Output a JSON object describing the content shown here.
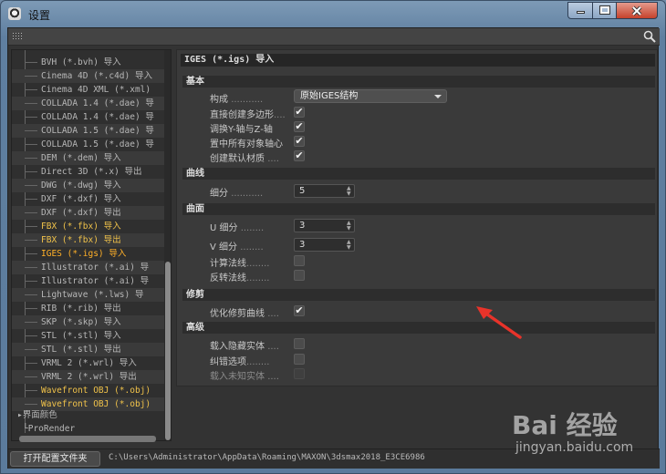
{
  "window": {
    "title": "设置"
  },
  "tree": {
    "items": [
      {
        "label": "BVH (*.bvh) 导入",
        "style": "normal"
      },
      {
        "label": "Cinema 4D (*.c4d) 导入",
        "style": "normal"
      },
      {
        "label": "Cinema 4D XML (*.xml)",
        "style": "normal"
      },
      {
        "label": "COLLADA 1.4 (*.dae) 导",
        "style": "normal"
      },
      {
        "label": "COLLADA 1.4 (*.dae) 导",
        "style": "normal"
      },
      {
        "label": "COLLADA 1.5 (*.dae) 导",
        "style": "normal"
      },
      {
        "label": "COLLADA 1.5 (*.dae) 导",
        "style": "normal"
      },
      {
        "label": "DEM (*.dem) 导入",
        "style": "normal"
      },
      {
        "label": "Direct 3D (*.x) 导出",
        "style": "normal"
      },
      {
        "label": "DWG (*.dwg) 导入",
        "style": "normal"
      },
      {
        "label": "DXF (*.dxf) 导入",
        "style": "normal"
      },
      {
        "label": "DXF (*.dxf) 导出",
        "style": "normal"
      },
      {
        "label": "FBX (*.fbx) 导入",
        "style": "highlight"
      },
      {
        "label": "FBX (*.fbx) 导出",
        "style": "highlight"
      },
      {
        "label": "IGES (*.igs) 导入",
        "style": "selected"
      },
      {
        "label": "Illustrator (*.ai) 导",
        "style": "normal"
      },
      {
        "label": "Illustrator (*.ai) 导",
        "style": "normal"
      },
      {
        "label": "Lightwave (*.lws) 导",
        "style": "normal"
      },
      {
        "label": "RIB (*.rib) 导出",
        "style": "normal"
      },
      {
        "label": "SKP (*.skp) 导入",
        "style": "normal"
      },
      {
        "label": "STL (*.stl) 导入",
        "style": "normal"
      },
      {
        "label": "STL (*.stl) 导出",
        "style": "normal"
      },
      {
        "label": "VRML 2 (*.wrl) 导入",
        "style": "normal"
      },
      {
        "label": "VRML 2 (*.wrl) 导出",
        "style": "normal"
      },
      {
        "label": "Wavefront OBJ (*.obj)",
        "style": "highlight"
      },
      {
        "label": "Wavefront OBJ (*.obj)",
        "style": "highlight"
      }
    ],
    "top_items": [
      "界面颜色",
      "ProRender"
    ]
  },
  "panel": {
    "header": "IGES (*.igs) 导入",
    "sections": {
      "basic": "基本",
      "curve": "曲线",
      "surface": "曲面",
      "trim": "修剪",
      "advanced": "高级"
    },
    "basic": {
      "structure_label": "构成",
      "structure_value": "原始IGES结构",
      "direct_polygon": "直接创建多边形",
      "swap_yz": "调换Y-轴与Z-轴",
      "center_axis": "置中所有对象轴心",
      "default_material": "创建默认材质"
    },
    "curve": {
      "subdiv_label": "细分",
      "subdiv_value": "5"
    },
    "surface": {
      "u_label": "U 细分",
      "u_value": "3",
      "v_label": "V 细分",
      "v_value": "3",
      "calc_normals": "计算法线",
      "flip_normals": "反转法线"
    },
    "trim": {
      "optimize": "优化修剪曲线"
    },
    "advanced": {
      "load_hidden": "载入隐藏实体",
      "error_options": "纠错选项",
      "load_unknown": "载入未知实体"
    },
    "dots_long": "...........",
    "dots_mid": "........",
    "dots_short": "...."
  },
  "bottom": {
    "open_folder": "打开配置文件夹",
    "path": "C:\\Users\\Administrator\\AppData\\Roaming\\MAXON\\3dsmax2018_E3CE6986"
  },
  "watermark": {
    "brand": "Bai 经验",
    "sub": "jingyan.baidu.com"
  },
  "colors": {
    "selected": "#ffb028",
    "highlight": "#f0c24a",
    "arrow": "#e8332a"
  }
}
